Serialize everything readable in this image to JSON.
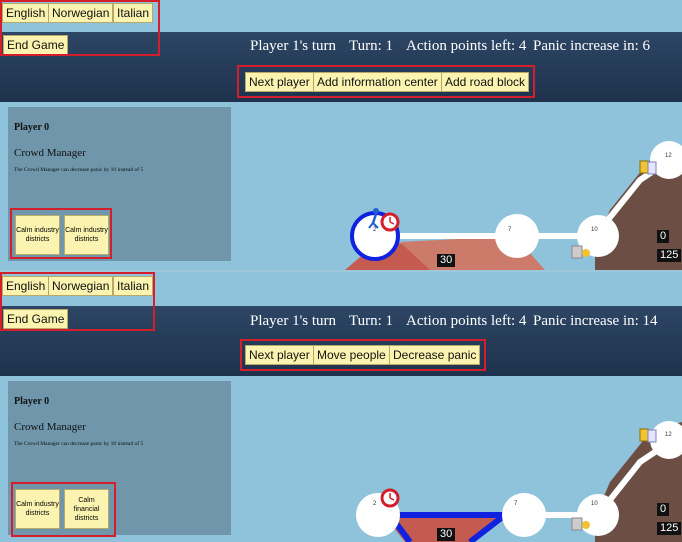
{
  "panels": [
    {
      "languages": [
        "English",
        "Norwegian",
        "Italian"
      ],
      "end_game": "End Game",
      "status": {
        "turn_player": "Player 1's turn",
        "turn": "Turn: 1",
        "action_points": "Action points left: 4",
        "panic": "Panic increase in: 6"
      },
      "actions": [
        "Next player",
        "Add information center",
        "Add road block"
      ],
      "player_info": {
        "name": "Player 0",
        "role": "Crowd Manager",
        "description": "The Crowd Manager can decrease panic by 10 instead of 5"
      },
      "cards": [
        "Calm industry districts",
        "Calm industry districts"
      ],
      "map": {
        "node_labels": [
          "2",
          "7",
          "10",
          "12"
        ],
        "numbers": [
          "30",
          "0",
          "125"
        ]
      }
    },
    {
      "languages": [
        "English",
        "Norwegian",
        "Italian"
      ],
      "end_game": "End Game",
      "status": {
        "turn_player": "Player 1's turn",
        "turn": "Turn: 1",
        "action_points": "Action points left: 4",
        "panic": "Panic increase in: 14"
      },
      "actions": [
        "Next player",
        "Move people",
        "Decrease panic"
      ],
      "player_info": {
        "name": "Player 0",
        "role": "Crowd Manager",
        "description": "The Crowd Manager can decrease panic by 10 instead of 5"
      },
      "cards": [
        "Calm industry districts",
        "Calm financial districts"
      ],
      "map": {
        "node_labels": [
          "2",
          "7",
          "10",
          "12"
        ],
        "numbers": [
          "30",
          "0",
          "125"
        ]
      }
    }
  ],
  "colors": {
    "highlight": "#d21f2b",
    "button_bg": "#fbf4b0",
    "topbar": "#253b58",
    "map_bg": "#8fc3db",
    "info_bg": "#6f96ab",
    "road": "#ffffff",
    "selected_road": "#1022e0"
  },
  "icons": [
    "walking-person-icon",
    "clock-icon",
    "information-center-icon",
    "road-block-icon"
  ]
}
